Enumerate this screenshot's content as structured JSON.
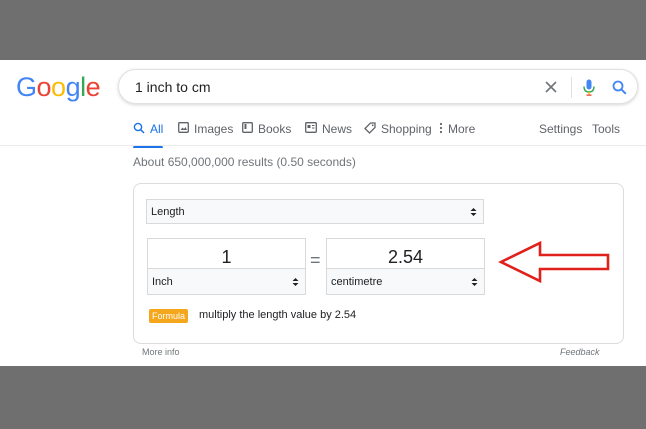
{
  "logo": {
    "letters": [
      "G",
      "o",
      "o",
      "g",
      "l",
      "e"
    ],
    "colors": [
      "#4285f4",
      "#ea4335",
      "#fbbc05",
      "#4285f4",
      "#34a853",
      "#ea4335"
    ]
  },
  "search": {
    "query": "1 inch to cm"
  },
  "tabs": [
    {
      "label": "All",
      "icon": "search-icon",
      "active": true
    },
    {
      "label": "Images",
      "icon": "image-icon"
    },
    {
      "label": "Books",
      "icon": "book-icon"
    },
    {
      "label": "News",
      "icon": "news-icon"
    },
    {
      "label": "Shopping",
      "icon": "tag-icon"
    },
    {
      "label": "More",
      "icon": "more-vertical-icon"
    },
    {
      "label": "Settings"
    },
    {
      "label": "Tools"
    }
  ],
  "stats": "About 650,000,000 results (0.50 seconds)",
  "converter": {
    "category": "Length",
    "from_value": "1",
    "from_unit": "Inch",
    "to_value": "2.54",
    "to_unit": "centimetre",
    "equals_sign": "=",
    "formula_label": "Formula",
    "formula_text": "multiply the length value by 2.54"
  },
  "footer": {
    "more_info": "More info",
    "feedback": "Feedback"
  },
  "colors": {
    "accent": "#1a73e8",
    "annotation_arrow": "#e0201b",
    "formula_badge": "#f4a61c"
  }
}
